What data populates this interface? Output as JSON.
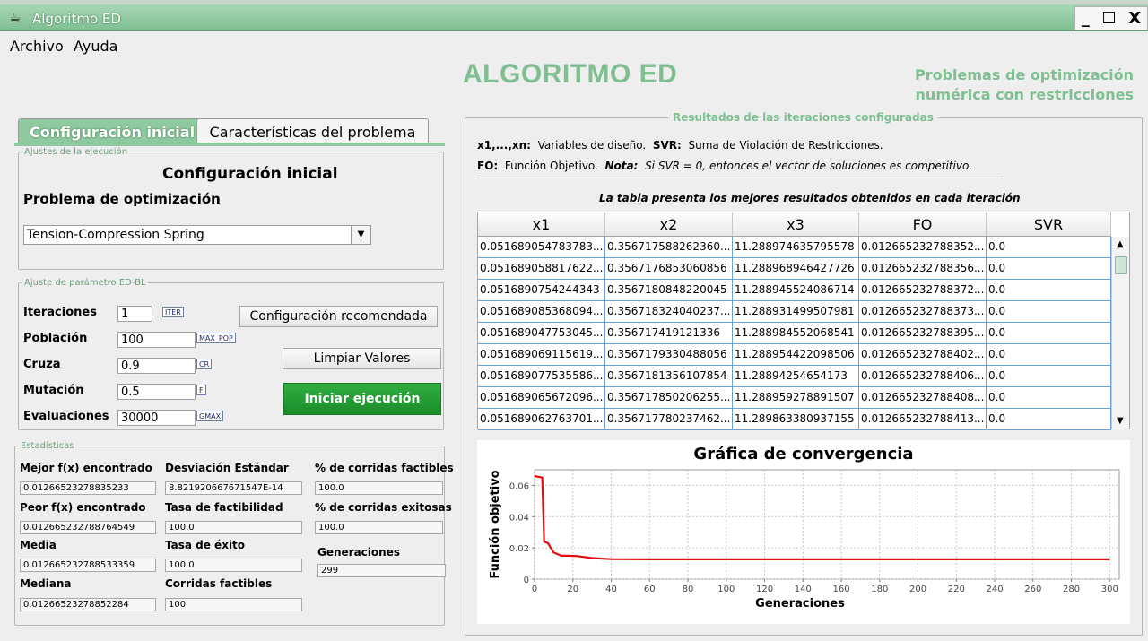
{
  "window": {
    "title": "Algoritmo ED",
    "controls": [
      "_",
      "☐",
      "X"
    ]
  },
  "menu": [
    "Archivo",
    "Ayuda"
  ],
  "header": {
    "title": "ALGORITMO ED",
    "subtitle_line1": "Problemas de optimización",
    "subtitle_line2": "numérica con restricciones"
  },
  "tabs": [
    "Configuración inicial",
    "Características del problema"
  ],
  "config": {
    "group_label": "Ajustes de la ejecución",
    "heading": "Configuración inicial",
    "problem_label": "Problema de optimización",
    "problem_selected": "Tension-Compression Spring"
  },
  "params": {
    "group_label": "Ajuste de parámetro ED-BL",
    "fields": [
      {
        "label": "Iteraciones",
        "value": "1",
        "tag": "ITER"
      },
      {
        "label": "Población",
        "value": "100",
        "tag": "MAX_POP"
      },
      {
        "label": "Cruza",
        "value": "0.9",
        "tag": "CR"
      },
      {
        "label": "Mutación",
        "value": "0.5",
        "tag": "F"
      },
      {
        "label": "Evaluaciones",
        "value": "30000",
        "tag": "GMAX"
      }
    ],
    "btn_recommended": "Configuración recomendada",
    "btn_clear": "Limpiar Valores",
    "btn_start": "Iniciar ejecución"
  },
  "stats": {
    "group_label": "Estadísticas",
    "items": [
      {
        "label": "Mejor f(x) encontrado",
        "value": "0.01266523278835233"
      },
      {
        "label": "Desviación Estándar",
        "value": "8.821920667671547E-14"
      },
      {
        "label": "% de corridas factibles",
        "value": "100.0"
      },
      {
        "label": "Peor f(x) encontrado",
        "value": "0.012665232788764549"
      },
      {
        "label": "Tasa de factibilidad",
        "value": "100.0"
      },
      {
        "label": "% de corridas exitosas",
        "value": "100.0"
      },
      {
        "label": "Media",
        "value": "0.012665232788533359"
      },
      {
        "label": "Tasa de éxito",
        "value": "100.0"
      },
      {
        "label": "Generaciones",
        "value": "299"
      },
      {
        "label": "Mediana",
        "value": "0.01266523278852284"
      },
      {
        "label": "Corridas factibles",
        "value": "100"
      }
    ]
  },
  "results": {
    "group_label": "Resultados de las iteraciones configuradas",
    "info1_key1": "x1,...,xn:",
    "info1_val1": "Variables de diseño.",
    "info1_key2": "SVR:",
    "info1_val2": "Suma de Violación de Restricciones.",
    "info2_key1": "FO:",
    "info2_val1": "Función Objetivo.",
    "info2_key2": "Nota:",
    "info2_val2": "Si SVR = 0, entonces el vector de soluciones es competitivo.",
    "caption": "La tabla presenta los mejores resultados obtenidos en cada iteración",
    "columns": [
      "x1",
      "x2",
      "x3",
      "FO",
      "SVR"
    ],
    "rows": [
      [
        "0.051689054783783...",
        "0.356717588262360...",
        "11.288974635795578",
        "0.012665232788352...",
        "0.0"
      ],
      [
        "0.051689058817622...",
        "0.3567176853060856",
        "11.288968946427726",
        "0.012665232788356...",
        "0.0"
      ],
      [
        "0.0516890754244343",
        "0.3567180848220045",
        "11.288945524086714",
        "0.012665232788372...",
        "0.0"
      ],
      [
        "0.051689085368094...",
        "0.356718324040237...",
        "11.288931499507981",
        "0.012665232788373...",
        "0.0"
      ],
      [
        "0.051689047753045...",
        "0.356717419121336",
        "11.288984552068541",
        "0.012665232788395...",
        "0.0"
      ],
      [
        "0.051689069115619...",
        "0.3567179330488056",
        "11.288954422098506",
        "0.012665232788402...",
        "0.0"
      ],
      [
        "0.051689077535586...",
        "0.3567181356107854",
        "11.28894254654173",
        "0.012665232788406...",
        "0.0"
      ],
      [
        "0.051689065672096...",
        "0.356717850206255...",
        "11.288959278891507",
        "0.012665232788408...",
        "0.0"
      ],
      [
        "0.051689062763701...",
        "0.356717780237462...",
        "11.289863380937155",
        "0.012665232788413...",
        "0.0"
      ]
    ]
  },
  "chart_data": {
    "type": "line",
    "title": "Gráfica de convergencia",
    "xlabel": "Generaciones",
    "ylabel": "Función objetivo",
    "xlim": [
      0,
      305
    ],
    "ylim": [
      0,
      0.07
    ],
    "xticks": [
      0,
      20,
      40,
      60,
      80,
      100,
      120,
      140,
      160,
      180,
      200,
      220,
      240,
      260,
      280,
      300
    ],
    "yticks": [
      0,
      0.02,
      0.04,
      0.06
    ],
    "ytick_labels": [
      "0",
      "0.02",
      "0.04",
      "0.06"
    ],
    "grid": true,
    "color": "#e01010",
    "x": [
      0,
      4,
      5,
      7,
      8,
      10,
      12,
      14,
      18,
      22,
      30,
      40,
      60,
      80,
      100,
      150,
      200,
      250,
      300
    ],
    "y": [
      0.066,
      0.065,
      0.024,
      0.023,
      0.021,
      0.017,
      0.016,
      0.015,
      0.015,
      0.0148,
      0.0135,
      0.0128,
      0.01268,
      0.01267,
      0.012666,
      0.012665,
      0.012665,
      0.012665,
      0.012665
    ]
  }
}
